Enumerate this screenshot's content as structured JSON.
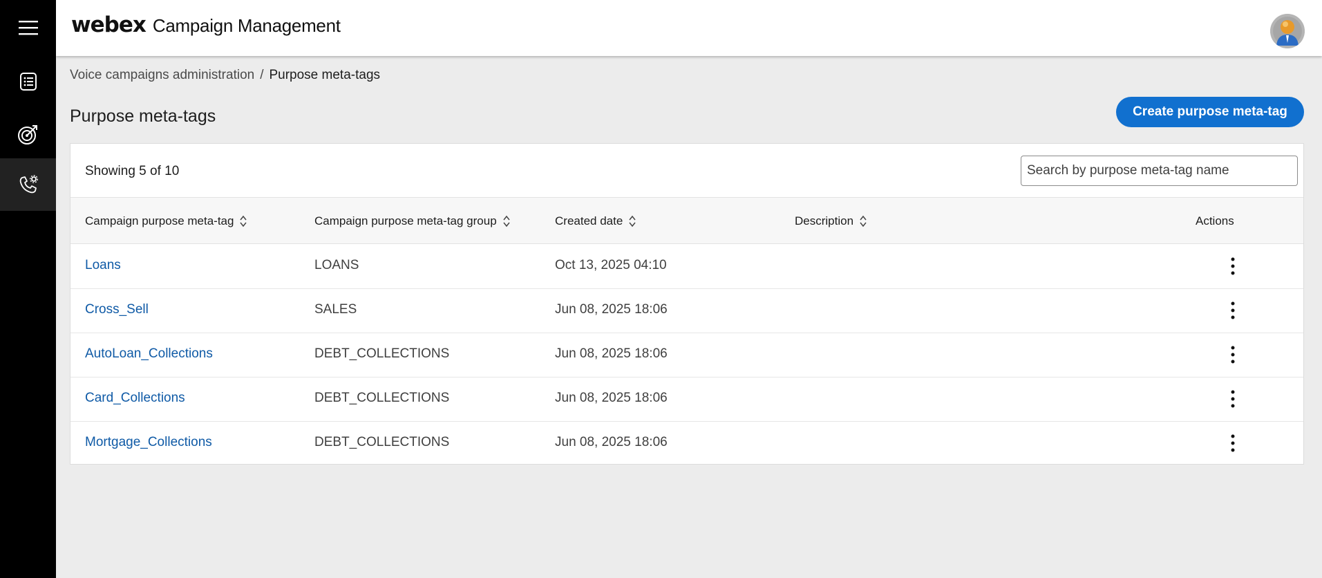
{
  "header": {
    "logo": "webex",
    "title": "Campaign Management"
  },
  "sidebar": {
    "items": [
      {
        "icon": "hamburger-menu-icon"
      },
      {
        "icon": "list-document-icon"
      },
      {
        "icon": "target-icon"
      },
      {
        "icon": "phone-settings-icon",
        "active": true
      }
    ]
  },
  "breadcrumb": {
    "parent": "Voice campaigns administration",
    "separator": "/",
    "current": "Purpose meta-tags"
  },
  "page": {
    "title": "Purpose meta-tags",
    "create_button": "Create purpose meta-tag"
  },
  "table": {
    "showing": "Showing 5 of 10",
    "search_placeholder": "Search by purpose meta-tag name",
    "columns": {
      "name": "Campaign purpose meta-tag",
      "group": "Campaign purpose meta-tag group",
      "created": "Created date",
      "description": "Description",
      "actions": "Actions"
    },
    "rows": [
      {
        "name": "Loans",
        "group": "LOANS",
        "created": "Oct 13, 2025 04:10",
        "description": ""
      },
      {
        "name": "Cross_Sell",
        "group": "SALES",
        "created": "Jun 08, 2025 18:06",
        "description": ""
      },
      {
        "name": "AutoLoan_Collections",
        "group": "DEBT_COLLECTIONS",
        "created": "Jun 08, 2025 18:06",
        "description": ""
      },
      {
        "name": "Card_Collections",
        "group": "DEBT_COLLECTIONS",
        "created": "Jun 08, 2025 18:06",
        "description": ""
      },
      {
        "name": "Mortgage_Collections",
        "group": "DEBT_COLLECTIONS",
        "created": "Jun 08, 2025 18:06",
        "description": ""
      }
    ]
  },
  "colors": {
    "accent": "#1170cf",
    "link": "#0f5aa6",
    "sidebar": "#000000"
  }
}
